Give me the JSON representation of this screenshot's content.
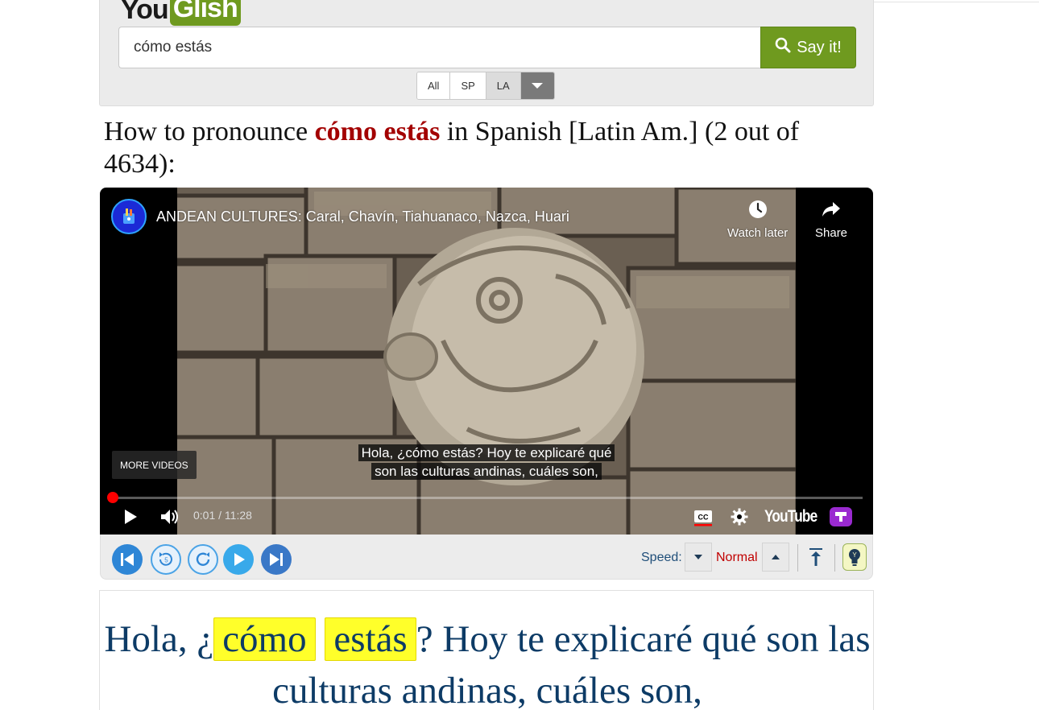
{
  "header": {
    "logo_you": "You",
    "logo_glish": "Glish",
    "search_value": "cómo estás",
    "say_button_label": "Say it!",
    "accent_options": [
      "All",
      "SP",
      "LA"
    ],
    "accent_selected": "LA"
  },
  "result_title": {
    "prefix": "How to pronounce ",
    "query": "cómo estás",
    "suffix": " in Spanish [Latin Am.] (2 out of 4634):"
  },
  "video": {
    "title": "ANDEAN CULTURES: Caral, Chavín, Tiahuanaco, Nazca, Huari",
    "watch_later_label": "Watch later",
    "share_label": "Share",
    "more_videos_label": "MORE VIDEOS",
    "caption_line1": "Hola, ¿cómo estás? Hoy te explicaré qué",
    "caption_line2": "son las culturas andinas, cuáles son,",
    "time_display": "0:01 / 11:28",
    "progress_fraction": 0.005,
    "youtube_label": "YouTube"
  },
  "toolbar": {
    "speed_label": "Speed:",
    "speed_value": "Normal"
  },
  "caption_panel": {
    "before": "Hola, ¿",
    "word1": "cómo",
    "word2": "estás",
    "after": "? Hoy te explicaré qué son las culturas andinas, cuáles son,"
  },
  "colors": {
    "brand_green": "#6f9a1f",
    "query_red": "#a30000",
    "caption_blue": "#0d3b66",
    "highlight_yellow": "#ffff2a",
    "progress_red": "#ff0000"
  }
}
